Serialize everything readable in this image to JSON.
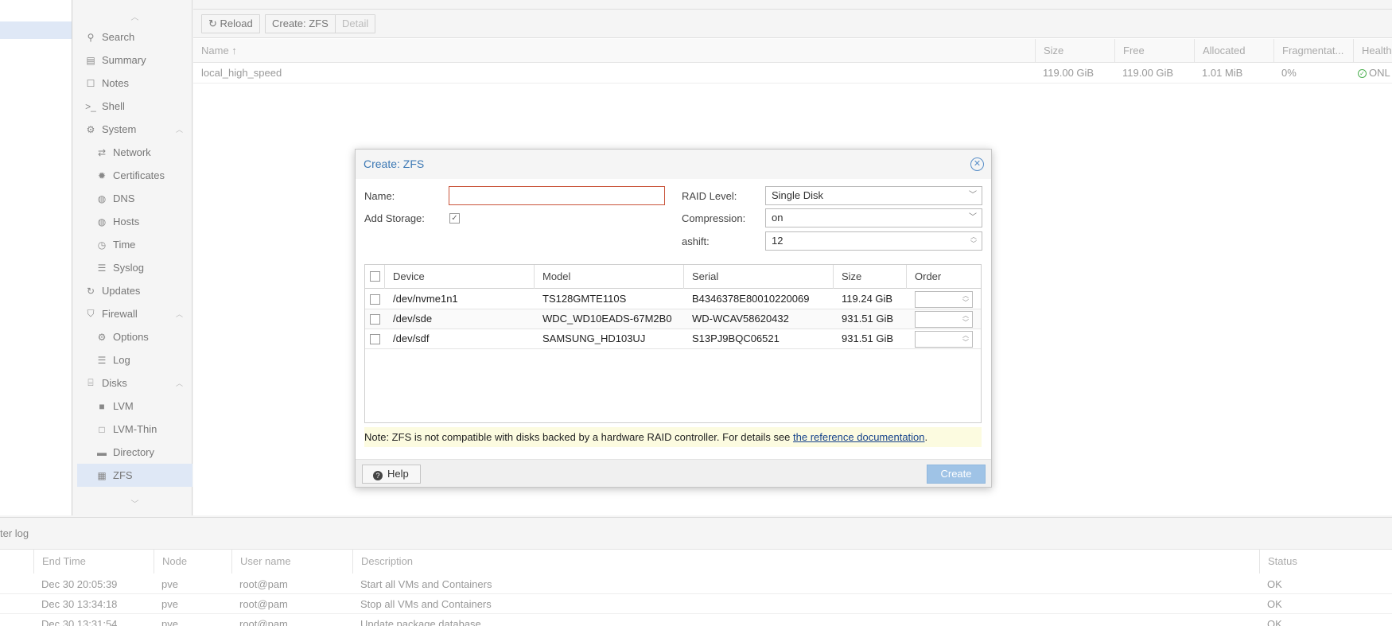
{
  "nav": {
    "items": [
      {
        "label": "Search",
        "icon": "search-icon",
        "glyph": "⚲"
      },
      {
        "label": "Summary",
        "icon": "book-icon",
        "glyph": "▤"
      },
      {
        "label": "Notes",
        "icon": "note-icon",
        "glyph": "☐"
      },
      {
        "label": "Shell",
        "icon": "terminal-icon",
        "glyph": ">_"
      },
      {
        "label": "System",
        "icon": "gears-icon",
        "glyph": "⚙"
      },
      {
        "label": "Network",
        "icon": "exchange-icon",
        "glyph": "⇄"
      },
      {
        "label": "Certificates",
        "icon": "certificate-icon",
        "glyph": "✹"
      },
      {
        "label": "DNS",
        "icon": "globe-icon",
        "glyph": "◍"
      },
      {
        "label": "Hosts",
        "icon": "globe-icon",
        "glyph": "◍"
      },
      {
        "label": "Time",
        "icon": "clock-icon",
        "glyph": "◷"
      },
      {
        "label": "Syslog",
        "icon": "list-icon",
        "glyph": "☰"
      },
      {
        "label": "Updates",
        "icon": "refresh-icon",
        "glyph": "↻"
      },
      {
        "label": "Firewall",
        "icon": "shield-icon",
        "glyph": "⛉"
      },
      {
        "label": "Options",
        "icon": "gear-icon",
        "glyph": "⚙"
      },
      {
        "label": "Log",
        "icon": "list-icon",
        "glyph": "☰"
      },
      {
        "label": "Disks",
        "icon": "hdd-icon",
        "glyph": "⌸"
      },
      {
        "label": "LVM",
        "icon": "square-icon",
        "glyph": "■"
      },
      {
        "label": "LVM-Thin",
        "icon": "square-outline-icon",
        "glyph": "□"
      },
      {
        "label": "Directory",
        "icon": "folder-icon",
        "glyph": "▬"
      },
      {
        "label": "ZFS",
        "icon": "grid-icon",
        "glyph": "▦"
      }
    ]
  },
  "toolbar": {
    "reload_label": "Reload",
    "create_zfs_label": "Create: ZFS",
    "detail_label": "Detail"
  },
  "pool_grid": {
    "headers": [
      "Name ↑",
      "Size",
      "Free",
      "Allocated",
      "Fragmentat...",
      "Health"
    ],
    "row": {
      "name": "local_high_speed",
      "size": "119.00 GiB",
      "free": "119.00 GiB",
      "allocated": "1.01 MiB",
      "frag": "0%",
      "health": "ONL"
    }
  },
  "task_log": {
    "title": "ter log",
    "headers": [
      "End Time",
      "Node",
      "User name",
      "Description",
      "Status"
    ],
    "rows": [
      {
        "end": "Dec 30 20:05:39",
        "node": "pve",
        "user": "root@pam",
        "desc": "Start all VMs and Containers",
        "status": "OK"
      },
      {
        "end": "Dec 30 13:34:18",
        "node": "pve",
        "user": "root@pam",
        "desc": "Stop all VMs and Containers",
        "status": "OK"
      },
      {
        "end": "Dec 30 13:31:54",
        "node": "pve",
        "user": "root@pam",
        "desc": "Update package database",
        "status": "OK"
      }
    ]
  },
  "dialog": {
    "title": "Create: ZFS",
    "name_label": "Name:",
    "name_value": "",
    "add_storage_label": "Add Storage:",
    "add_storage_checked": "✓",
    "raid_label": "RAID Level:",
    "raid_value": "Single Disk",
    "compression_label": "Compression:",
    "compression_value": "on",
    "ashift_label": "ashift:",
    "ashift_value": "12",
    "grid_headers": [
      "Device",
      "Model",
      "Serial",
      "Size",
      "Order"
    ],
    "disks": [
      {
        "device": "/dev/nvme1n1",
        "model": "TS128GMTE110S",
        "serial": "B4346378E80010220069",
        "size": "119.24 GiB"
      },
      {
        "device": "/dev/sde",
        "model": "WDC_WD10EADS-67M2B0",
        "serial": "WD-WCAV58620432",
        "size": "931.51 GiB"
      },
      {
        "device": "/dev/sdf",
        "model": "SAMSUNG_HD103UJ",
        "serial": "S13PJ9BQC06521",
        "size": "931.51 GiB"
      }
    ],
    "note_text": "Note: ZFS is not compatible with disks backed by a hardware RAID controller. For details see ",
    "note_link": "the reference documentation",
    "note_end": ".",
    "help_label": "Help",
    "create_label": "Create"
  },
  "colors": {
    "accent": "#3c78b4",
    "create_button": "#9fc3e6",
    "invalid_border": "#c9543a",
    "note_bg": "#fcfbe0",
    "selection": "#dfe8f6"
  }
}
